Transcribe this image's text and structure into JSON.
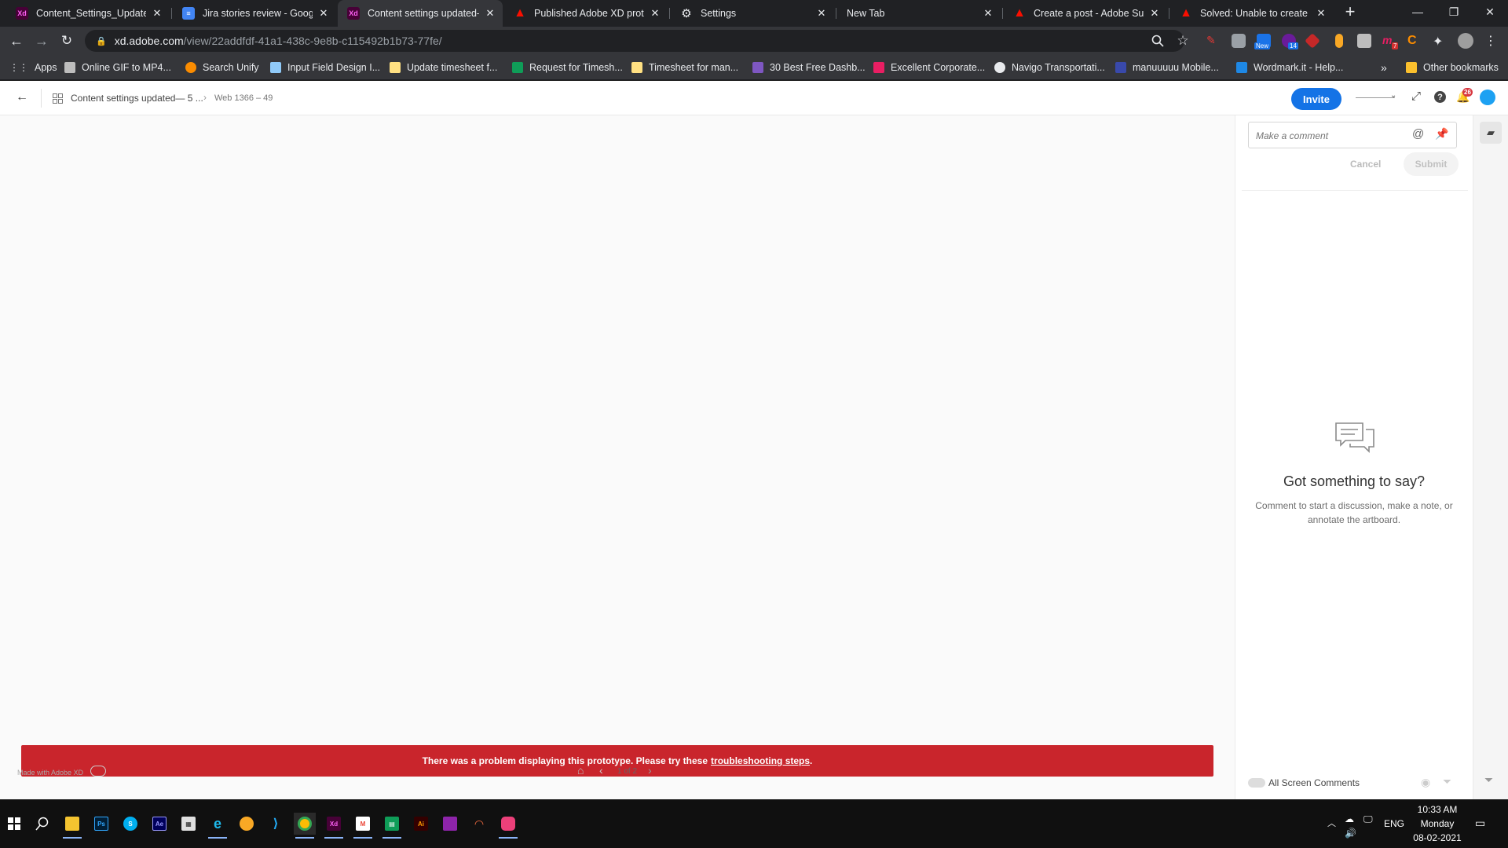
{
  "colors": {
    "adobe_blue": "#1473e6",
    "error_red": "#c9252c",
    "xd_pink": "#470137"
  },
  "tabs": [
    {
      "title": "Content_Settings_Updated",
      "icon": "adobe-xd-icon"
    },
    {
      "title": "Jira stories review - Google",
      "icon": "google-docs-icon"
    },
    {
      "title": "Content settings updated—",
      "icon": "adobe-xd-icon",
      "active": true
    },
    {
      "title": "Published Adobe XD protot",
      "icon": "adobe-icon"
    },
    {
      "title": "Settings",
      "icon": "gear-icon"
    },
    {
      "title": "New Tab",
      "icon": ""
    },
    {
      "title": "Create a post - Adobe Supp",
      "icon": "adobe-icon"
    },
    {
      "title": "Solved: Unable to create a p",
      "icon": "adobe-icon"
    }
  ],
  "address": {
    "host": "xd.adobe.com",
    "path": "/view/22addfdf-41a1-438c-9e8b-c115492b1b73-77fe/"
  },
  "extensions": {
    "new_badge": "New",
    "count_badge": "14",
    "notif_badge": "7"
  },
  "bookmarks": [
    "Apps",
    "Online GIF to MP4...",
    "Search Unify",
    "Input Field Design I...",
    "Update timesheet f...",
    "Request for Timesh...",
    "Timesheet for man...",
    "30 Best Free Dashb...",
    "Excellent Corporate...",
    "Navigo Transportati...",
    "manuuuuu Mobile...",
    "Wordmark.it - Help..."
  ],
  "bookmarks_more": "»",
  "other_bookmarks": "Other bookmarks",
  "xd": {
    "doc_title": "Content settings updated— 5 ...",
    "artboard": "Web 1366 – 49",
    "invite": "Invite",
    "notif_count": "26",
    "comment_placeholder": "Make a comment",
    "cancel": "Cancel",
    "submit": "Submit",
    "empty_title": "Got something to say?",
    "empty_body": "Comment to start a discussion, make a note, or annotate the artboard.",
    "all_screen_comments": "All Screen Comments",
    "error_text": "There was a problem displaying this prototype. Please try these",
    "error_link": "troubleshooting steps",
    "error_end": ".",
    "made_with": "Made with Adobe XD",
    "page_indicator": "1 of 2"
  },
  "taskbar": {
    "lang": "ENG",
    "time": "10:33 AM",
    "day": "Monday",
    "date": "08-02-2021"
  }
}
